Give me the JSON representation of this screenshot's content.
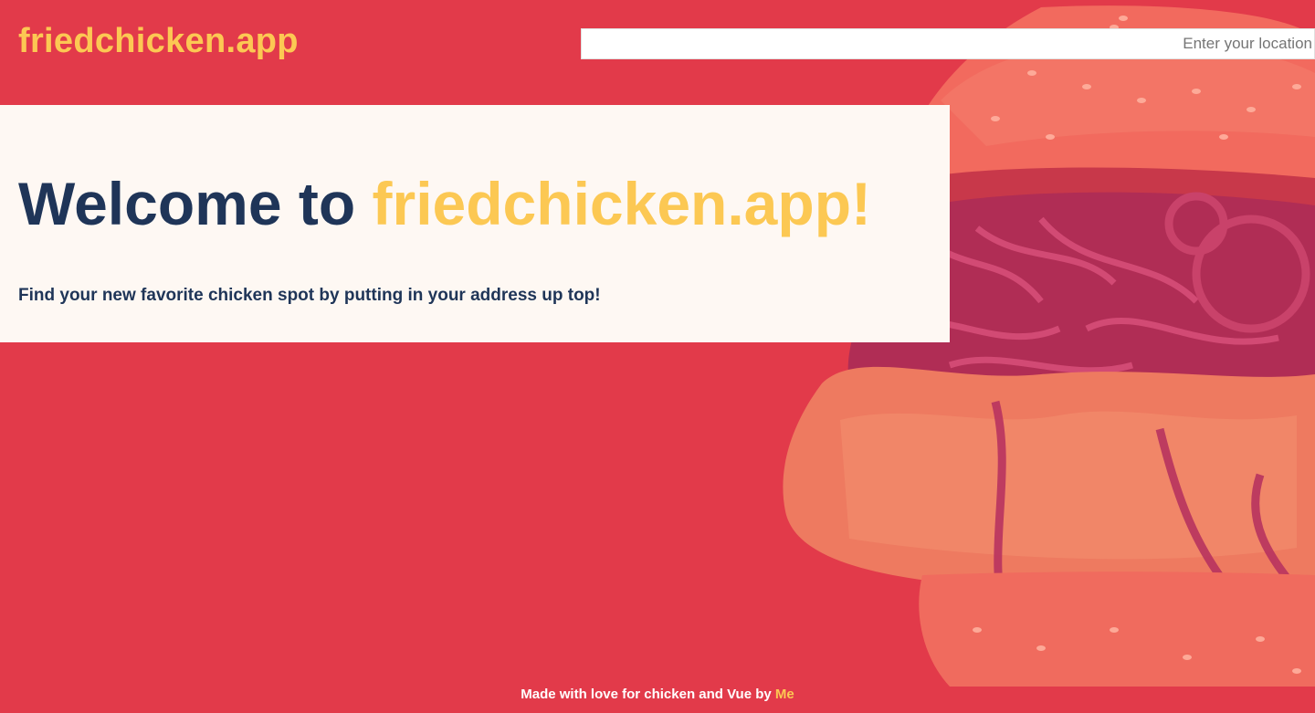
{
  "header": {
    "brand": "friedchicken.app",
    "location_placeholder": "Enter your location",
    "location_value": ""
  },
  "welcome": {
    "title_prefix": "Welcome to",
    "title_brand": "friedchicken.app!",
    "subtitle": "Find your new favorite chicken spot by putting in your address up top!"
  },
  "footer": {
    "text": "Made with love for chicken and Vue by",
    "link_label": "Me"
  },
  "hero_image": {
    "subject": "fried chicken sandwich with sesame bun, slaw and jalapeños"
  },
  "colors": {
    "background": "#e23a4a",
    "brand_yellow": "#fcc853",
    "navy": "#1f3558",
    "panel": "#fef8f3"
  }
}
